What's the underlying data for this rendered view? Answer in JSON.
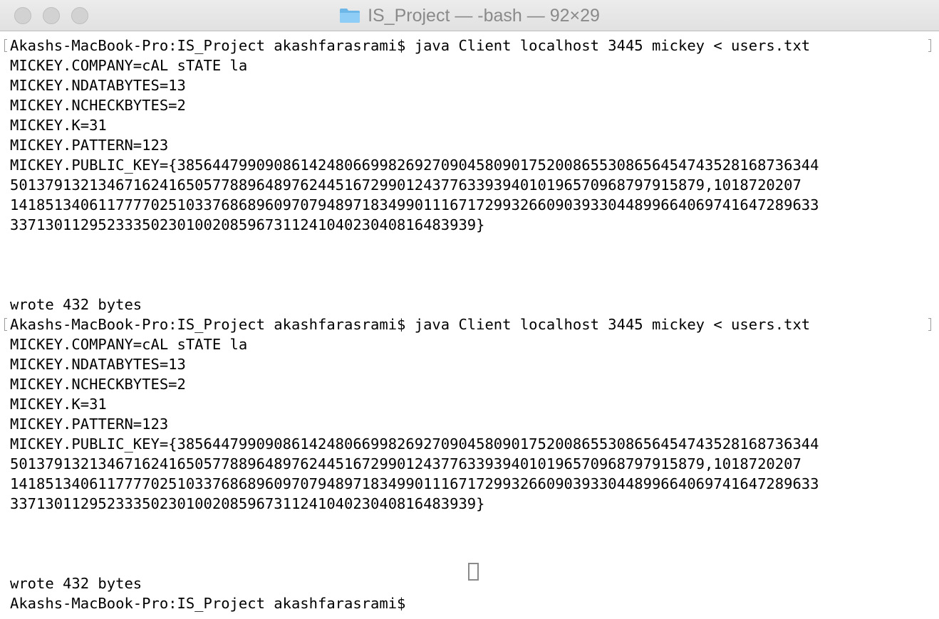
{
  "window": {
    "title": "IS_Project — -bash — 92×29",
    "icon": "folder-icon"
  },
  "terminal": {
    "lines": [
      "Akashs-MacBook-Pro:IS_Project akashfarasrami$ java Client localhost 3445 mickey < users.txt",
      "MICKEY.COMPANY=cAL sTATE la",
      "MICKEY.NDATABYTES=13",
      "MICKEY.NCHECKBYTES=2",
      "MICKEY.K=31",
      "MICKEY.PATTERN=123",
      "MICKEY.PUBLIC_KEY={3856447990908614248066998269270904580901752008655308656454743528168736344",
      "5013791321346716241650577889648976244516729901243776339394010196570968797915879,1018720207",
      "1418513406117777025103376868960970794897183499011167172993266090393304489966406974164728963​3",
      "337130112952333502301002085967311241040230408164839​39}",
      "",
      "",
      "",
      "wrote 432 bytes",
      "Akashs-MacBook-Pro:IS_Project akashfarasrami$ java Client localhost 3445 mickey < users.txt",
      "MICKEY.COMPANY=cAL sTATE la",
      "MICKEY.NDATABYTES=13",
      "MICKEY.NCHECKBYTES=2",
      "MICKEY.K=31",
      "MICKEY.PATTERN=123",
      "MICKEY.PUBLIC_KEY={3856447990908614248066998269270904580901752008655308656454743528168736344",
      "5013791321346716241650577889648976244516729901243776339394010196570968797915879,1018720207",
      "1418513406117777025103376868960970794897183499011167172993266090393304489966406974164728963​3",
      "337130112952333502301002085967311241040230408164839​39}",
      "",
      "",
      "",
      "wrote 432 bytes",
      "Akashs-MacBook-Pro:IS_Project akashfarasrami$ "
    ]
  }
}
